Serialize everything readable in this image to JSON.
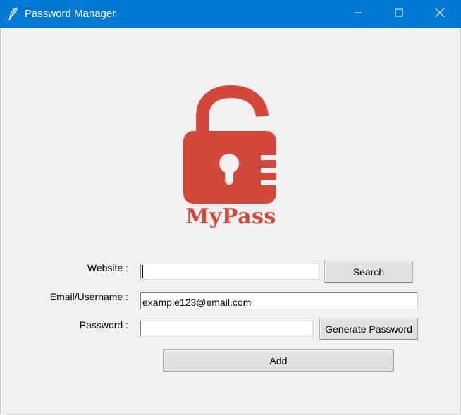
{
  "window": {
    "title": "Password Manager",
    "controls": [
      "minimize-icon",
      "maximize-icon",
      "close-icon"
    ]
  },
  "logo": {
    "icon": "padlock-icon",
    "text": "MyPass",
    "color": "#d4483b"
  },
  "form": {
    "website_label": "Website :",
    "website_value": "",
    "email_label": "Email/Username :",
    "email_value": "example123@email.com",
    "password_label": "Password :",
    "password_value": ""
  },
  "buttons": {
    "search": "Search",
    "generate": "Generate Password",
    "add": "Add"
  },
  "colors": {
    "titlebar": "#0078d4",
    "background": "#f0f0f0"
  }
}
